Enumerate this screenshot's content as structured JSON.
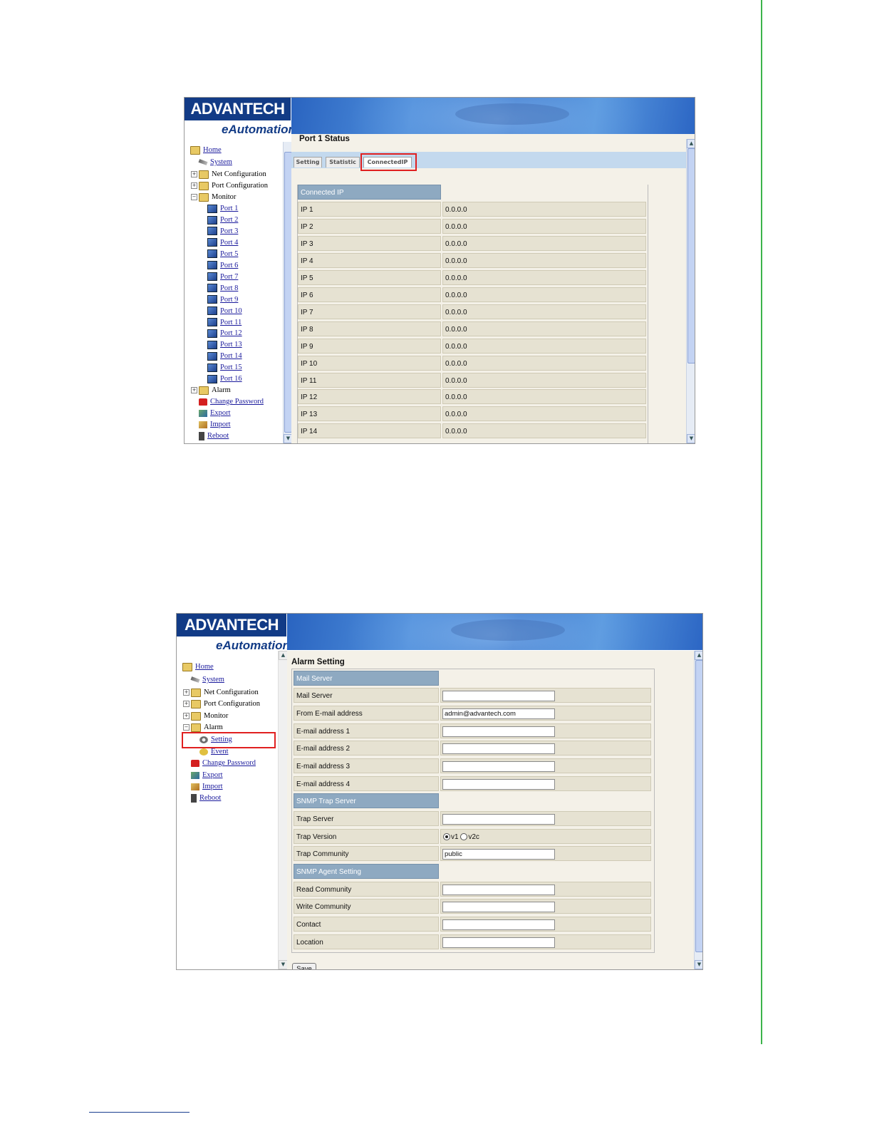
{
  "colors": {
    "accent_green": "#3cb44b",
    "brand_blue": "#123b86",
    "header_cell": "#8ea9c1",
    "highlight_red": "#e02020"
  },
  "brand": {
    "logo_text": "ADVANTECH",
    "sub_text": "eAutomation"
  },
  "screen1": {
    "title": "Port 1 Status",
    "tabs": [
      {
        "label": "Setting"
      },
      {
        "label": "Statistic"
      },
      {
        "label": "ConnectedIP"
      }
    ],
    "active_tab": "ConnectedIP",
    "sidebar": {
      "home": "Home",
      "system": "System",
      "net_config": "Net Configuration",
      "port_config": "Port Configuration",
      "monitor": "Monitor",
      "ports": [
        "Port 1",
        "Port 2",
        "Port 3",
        "Port 4",
        "Port 5",
        "Port 6",
        "Port 7",
        "Port 8",
        "Port 9",
        "Port 10",
        "Port 11",
        "Port 12",
        "Port 13",
        "Port 14",
        "Port 15",
        "Port 16"
      ],
      "alarm": "Alarm",
      "change_password": "Change Password",
      "export": "Export",
      "import": "Import",
      "reboot": "Reboot"
    },
    "table": {
      "header": "Connected IP",
      "rows": [
        {
          "label": "IP 1",
          "value": "0.0.0.0"
        },
        {
          "label": "IP 2",
          "value": "0.0.0.0"
        },
        {
          "label": "IP 3",
          "value": "0.0.0.0"
        },
        {
          "label": "IP 4",
          "value": "0.0.0.0"
        },
        {
          "label": "IP 5",
          "value": "0.0.0.0"
        },
        {
          "label": "IP 6",
          "value": "0.0.0.0"
        },
        {
          "label": "IP 7",
          "value": "0.0.0.0"
        },
        {
          "label": "IP 8",
          "value": "0.0.0.0"
        },
        {
          "label": "IP 9",
          "value": "0.0.0.0"
        },
        {
          "label": "IP 10",
          "value": "0.0.0.0"
        },
        {
          "label": "IP 11",
          "value": "0.0.0.0"
        },
        {
          "label": "IP 12",
          "value": "0.0.0.0"
        },
        {
          "label": "IP 13",
          "value": "0.0.0.0"
        },
        {
          "label": "IP 14",
          "value": "0.0.0.0"
        }
      ]
    }
  },
  "screen2": {
    "title": "Alarm Setting",
    "sidebar": {
      "home": "Home",
      "system": "System",
      "net_config": "Net Configuration",
      "port_config": "Port Configuration",
      "monitor": "Monitor",
      "alarm": "Alarm",
      "setting": "Setting",
      "event": "Event",
      "change_password": "Change Password",
      "export": "Export",
      "import": "Import",
      "reboot": "Reboot"
    },
    "form": {
      "mail_section": "Mail Server",
      "mail_server_label": "Mail Server",
      "mail_server_value": "",
      "from_email_label": "From E-mail address",
      "from_email_value": "admin@advantech.com",
      "email1_label": "E-mail address 1",
      "email2_label": "E-mail address 2",
      "email3_label": "E-mail address 3",
      "email4_label": "E-mail address 4",
      "snmp_trap_section": "SNMP Trap Server",
      "trap_server_label": "Trap Server",
      "trap_version_label": "Trap Version",
      "trap_version_v1": "v1",
      "trap_version_v2c": "v2c",
      "trap_version_selected": "v1",
      "trap_community_label": "Trap Community",
      "trap_community_value": "public",
      "snmp_agent_section": "SNMP Agent Setting",
      "read_community_label": "Read Community",
      "write_community_label": "Write Community",
      "contact_label": "Contact",
      "location_label": "Location",
      "save_label": "Save"
    }
  }
}
